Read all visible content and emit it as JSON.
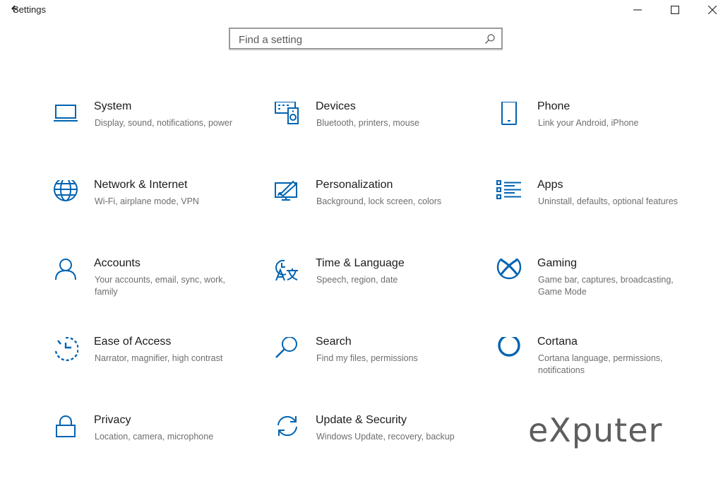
{
  "window": {
    "title": "Settings",
    "controls": {
      "minimize": "minimize",
      "maximize": "maximize",
      "close": "close"
    }
  },
  "search": {
    "placeholder": "Find a setting",
    "value": ""
  },
  "colors": {
    "accent": "#0063b1",
    "desc": "#6e6e6e"
  },
  "tiles": [
    {
      "title": "System",
      "desc": "Display, sound, notifications, power",
      "icon": "laptop-icon"
    },
    {
      "title": "Devices",
      "desc": "Bluetooth, printers, mouse",
      "icon": "keyboard-speaker-icon"
    },
    {
      "title": "Phone",
      "desc": "Link your Android, iPhone",
      "icon": "phone-icon"
    },
    {
      "title": "Network & Internet",
      "desc": "Wi-Fi, airplane mode, VPN",
      "icon": "globe-icon"
    },
    {
      "title": "Personalization",
      "desc": "Background, lock screen, colors",
      "icon": "paint-tablet-icon"
    },
    {
      "title": "Apps",
      "desc": "Uninstall, defaults, optional features",
      "icon": "apps-list-icon"
    },
    {
      "title": "Accounts",
      "desc": "Your accounts, email, sync, work, family",
      "icon": "person-icon"
    },
    {
      "title": "Time & Language",
      "desc": "Speech, region, date",
      "icon": "clock-language-icon"
    },
    {
      "title": "Gaming",
      "desc": "Game bar, captures, broadcasting, Game Mode",
      "icon": "xbox-icon"
    },
    {
      "title": "Ease of Access",
      "desc": "Narrator, magnifier, high contrast",
      "icon": "ease-of-access-icon"
    },
    {
      "title": "Search",
      "desc": "Find my files, permissions",
      "icon": "magnifier-icon"
    },
    {
      "title": "Cortana",
      "desc": "Cortana language, permissions, notifications",
      "icon": "cortana-icon"
    },
    {
      "title": "Privacy",
      "desc": "Location, camera, microphone",
      "icon": "lock-icon"
    },
    {
      "title": "Update & Security",
      "desc": "Windows Update, recovery, backup",
      "icon": "sync-arrows-icon"
    }
  ],
  "watermark": "eXputer"
}
